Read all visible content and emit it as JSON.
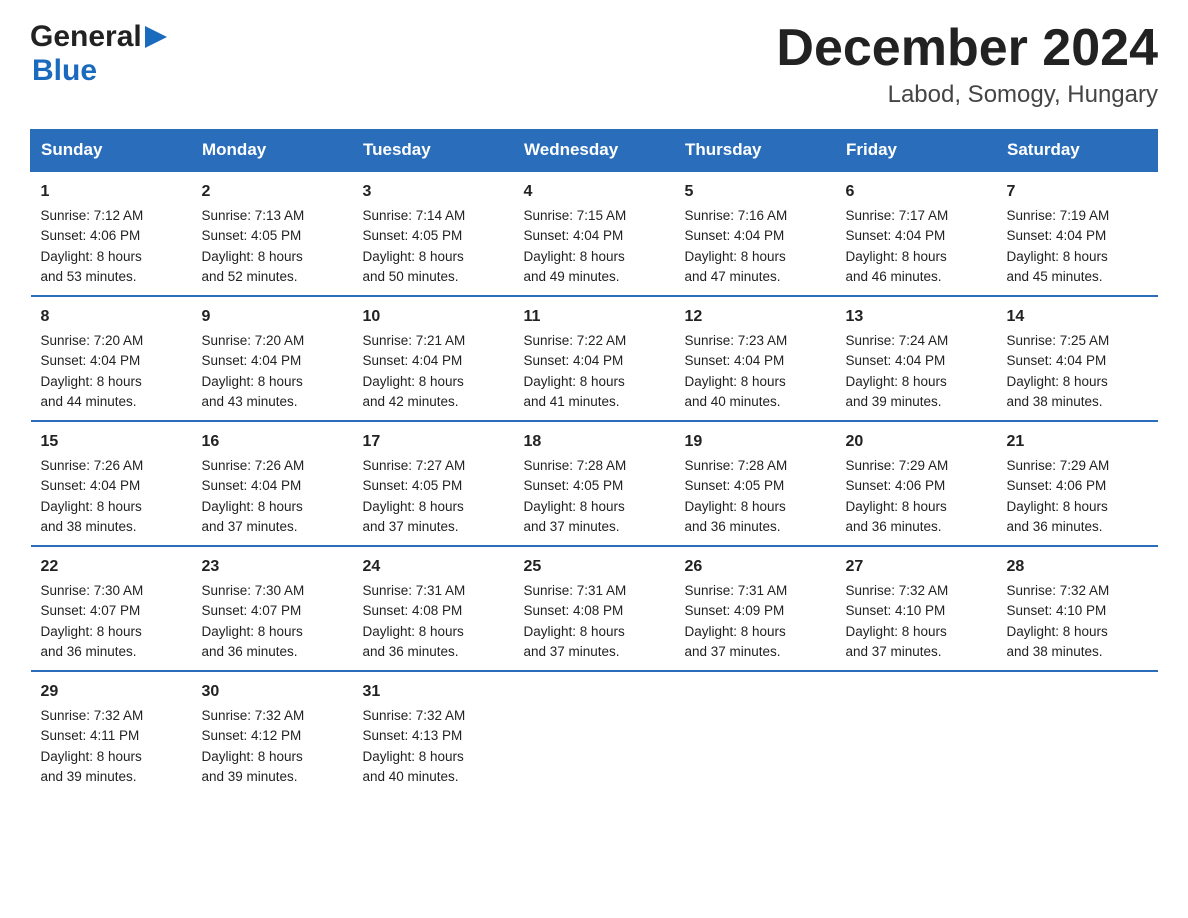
{
  "header": {
    "logo_general": "General",
    "logo_blue": "Blue",
    "main_title": "December 2024",
    "subtitle": "Labod, Somogy, Hungary"
  },
  "weekdays": [
    "Sunday",
    "Monday",
    "Tuesday",
    "Wednesday",
    "Thursday",
    "Friday",
    "Saturday"
  ],
  "rows": [
    [
      {
        "day": "1",
        "sunrise": "7:12 AM",
        "sunset": "4:06 PM",
        "daylight": "8 hours and 53 minutes."
      },
      {
        "day": "2",
        "sunrise": "7:13 AM",
        "sunset": "4:05 PM",
        "daylight": "8 hours and 52 minutes."
      },
      {
        "day": "3",
        "sunrise": "7:14 AM",
        "sunset": "4:05 PM",
        "daylight": "8 hours and 50 minutes."
      },
      {
        "day": "4",
        "sunrise": "7:15 AM",
        "sunset": "4:04 PM",
        "daylight": "8 hours and 49 minutes."
      },
      {
        "day": "5",
        "sunrise": "7:16 AM",
        "sunset": "4:04 PM",
        "daylight": "8 hours and 47 minutes."
      },
      {
        "day": "6",
        "sunrise": "7:17 AM",
        "sunset": "4:04 PM",
        "daylight": "8 hours and 46 minutes."
      },
      {
        "day": "7",
        "sunrise": "7:19 AM",
        "sunset": "4:04 PM",
        "daylight": "8 hours and 45 minutes."
      }
    ],
    [
      {
        "day": "8",
        "sunrise": "7:20 AM",
        "sunset": "4:04 PM",
        "daylight": "8 hours and 44 minutes."
      },
      {
        "day": "9",
        "sunrise": "7:20 AM",
        "sunset": "4:04 PM",
        "daylight": "8 hours and 43 minutes."
      },
      {
        "day": "10",
        "sunrise": "7:21 AM",
        "sunset": "4:04 PM",
        "daylight": "8 hours and 42 minutes."
      },
      {
        "day": "11",
        "sunrise": "7:22 AM",
        "sunset": "4:04 PM",
        "daylight": "8 hours and 41 minutes."
      },
      {
        "day": "12",
        "sunrise": "7:23 AM",
        "sunset": "4:04 PM",
        "daylight": "8 hours and 40 minutes."
      },
      {
        "day": "13",
        "sunrise": "7:24 AM",
        "sunset": "4:04 PM",
        "daylight": "8 hours and 39 minutes."
      },
      {
        "day": "14",
        "sunrise": "7:25 AM",
        "sunset": "4:04 PM",
        "daylight": "8 hours and 38 minutes."
      }
    ],
    [
      {
        "day": "15",
        "sunrise": "7:26 AM",
        "sunset": "4:04 PM",
        "daylight": "8 hours and 38 minutes."
      },
      {
        "day": "16",
        "sunrise": "7:26 AM",
        "sunset": "4:04 PM",
        "daylight": "8 hours and 37 minutes."
      },
      {
        "day": "17",
        "sunrise": "7:27 AM",
        "sunset": "4:05 PM",
        "daylight": "8 hours and 37 minutes."
      },
      {
        "day": "18",
        "sunrise": "7:28 AM",
        "sunset": "4:05 PM",
        "daylight": "8 hours and 37 minutes."
      },
      {
        "day": "19",
        "sunrise": "7:28 AM",
        "sunset": "4:05 PM",
        "daylight": "8 hours and 36 minutes."
      },
      {
        "day": "20",
        "sunrise": "7:29 AM",
        "sunset": "4:06 PM",
        "daylight": "8 hours and 36 minutes."
      },
      {
        "day": "21",
        "sunrise": "7:29 AM",
        "sunset": "4:06 PM",
        "daylight": "8 hours and 36 minutes."
      }
    ],
    [
      {
        "day": "22",
        "sunrise": "7:30 AM",
        "sunset": "4:07 PM",
        "daylight": "8 hours and 36 minutes."
      },
      {
        "day": "23",
        "sunrise": "7:30 AM",
        "sunset": "4:07 PM",
        "daylight": "8 hours and 36 minutes."
      },
      {
        "day": "24",
        "sunrise": "7:31 AM",
        "sunset": "4:08 PM",
        "daylight": "8 hours and 36 minutes."
      },
      {
        "day": "25",
        "sunrise": "7:31 AM",
        "sunset": "4:08 PM",
        "daylight": "8 hours and 37 minutes."
      },
      {
        "day": "26",
        "sunrise": "7:31 AM",
        "sunset": "4:09 PM",
        "daylight": "8 hours and 37 minutes."
      },
      {
        "day": "27",
        "sunrise": "7:32 AM",
        "sunset": "4:10 PM",
        "daylight": "8 hours and 37 minutes."
      },
      {
        "day": "28",
        "sunrise": "7:32 AM",
        "sunset": "4:10 PM",
        "daylight": "8 hours and 38 minutes."
      }
    ],
    [
      {
        "day": "29",
        "sunrise": "7:32 AM",
        "sunset": "4:11 PM",
        "daylight": "8 hours and 39 minutes."
      },
      {
        "day": "30",
        "sunrise": "7:32 AM",
        "sunset": "4:12 PM",
        "daylight": "8 hours and 39 minutes."
      },
      {
        "day": "31",
        "sunrise": "7:32 AM",
        "sunset": "4:13 PM",
        "daylight": "8 hours and 40 minutes."
      },
      null,
      null,
      null,
      null
    ]
  ],
  "labels": {
    "sunrise": "Sunrise:",
    "sunset": "Sunset:",
    "daylight": "Daylight:"
  }
}
